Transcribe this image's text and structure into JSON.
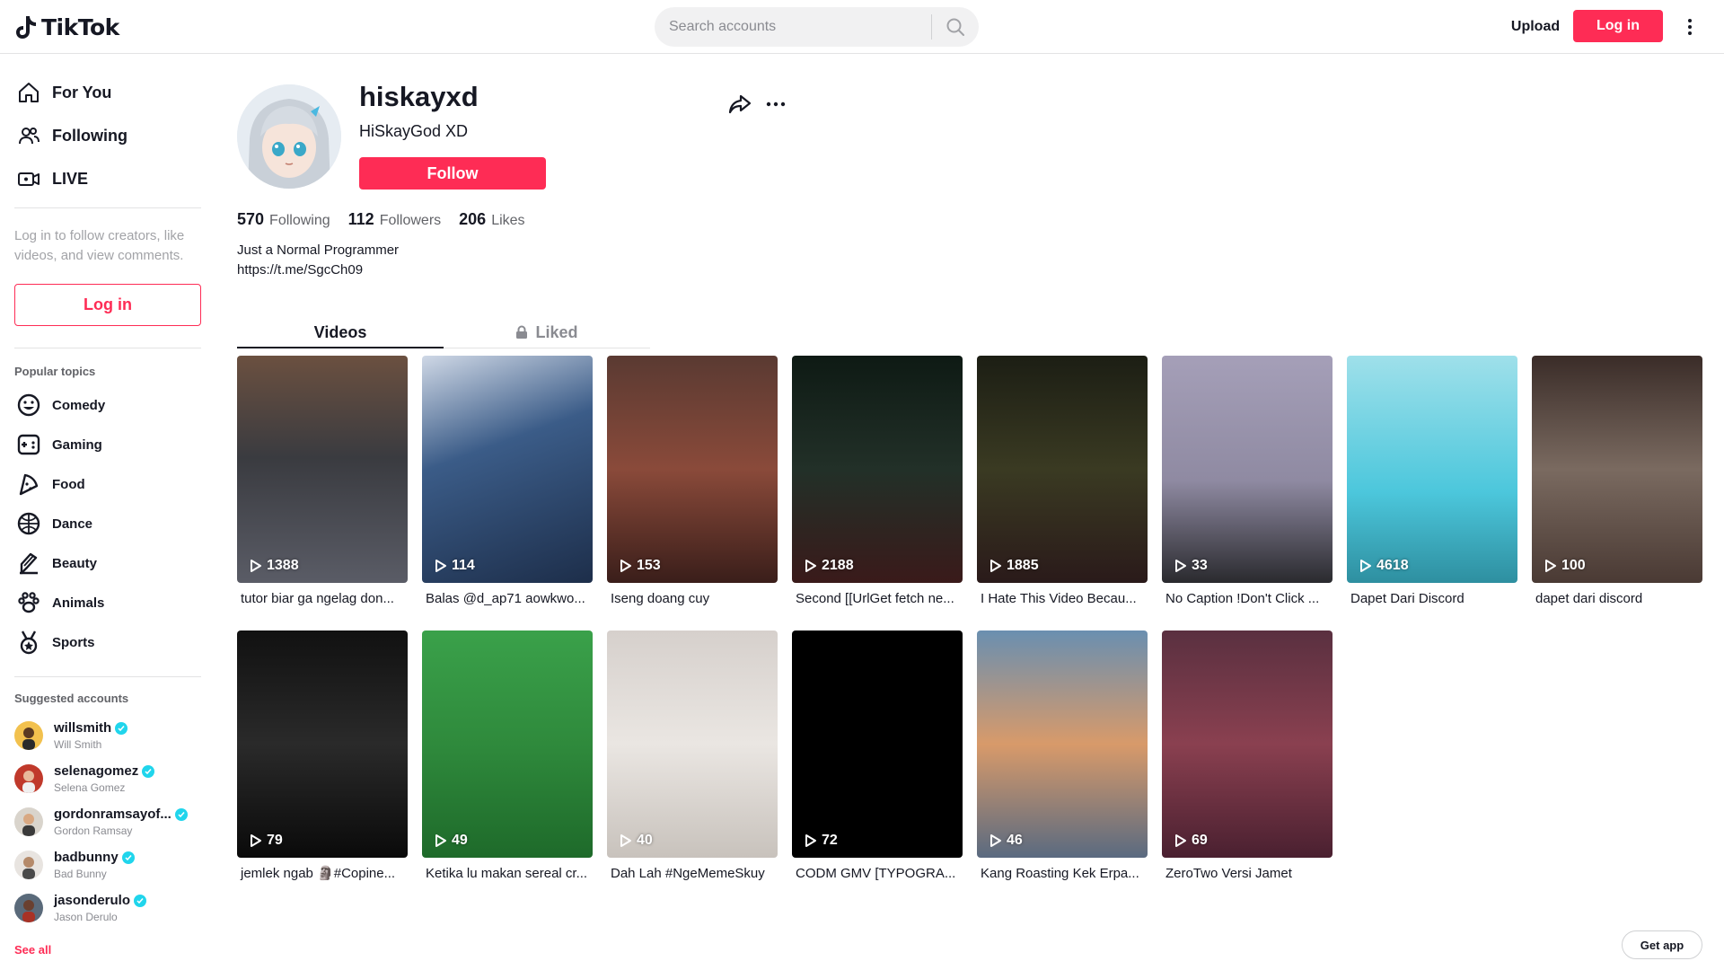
{
  "header": {
    "logo_text": "TikTok",
    "search_placeholder": "Search accounts",
    "upload_label": "Upload",
    "login_label": "Log in"
  },
  "sidebar": {
    "nav": [
      {
        "label": "For You",
        "icon": "home-icon"
      },
      {
        "label": "Following",
        "icon": "users-icon"
      },
      {
        "label": "LIVE",
        "icon": "live-icon"
      }
    ],
    "login_prompt": "Log in to follow creators, like videos, and view comments.",
    "login_button": "Log in",
    "popular_topics_title": "Popular topics",
    "topics": [
      {
        "label": "Comedy",
        "icon": "smile-icon"
      },
      {
        "label": "Gaming",
        "icon": "gamepad-icon"
      },
      {
        "label": "Food",
        "icon": "food-icon"
      },
      {
        "label": "Dance",
        "icon": "dance-icon"
      },
      {
        "label": "Beauty",
        "icon": "beauty-icon"
      },
      {
        "label": "Animals",
        "icon": "paw-icon"
      },
      {
        "label": "Sports",
        "icon": "medal-icon"
      }
    ],
    "suggested_title": "Suggested accounts",
    "suggested": [
      {
        "username": "willsmith",
        "nickname": "Will Smith",
        "color": "#f2c14e"
      },
      {
        "username": "selenagomez",
        "nickname": "Selena Gomez",
        "color": "#c0392b"
      },
      {
        "username": "gordonramsayof...",
        "nickname": "Gordon Ramsay",
        "color": "#6b5b4a"
      },
      {
        "username": "badbunny",
        "nickname": "Bad Bunny",
        "color": "#4a4a4a"
      },
      {
        "username": "jasonderulo",
        "nickname": "Jason Derulo",
        "color": "#a83226"
      }
    ],
    "see_all": "See all"
  },
  "profile": {
    "username": "hiskayxd",
    "nickname": "HiSkayGod XD",
    "follow_label": "Follow",
    "following_count": "570",
    "following_label": "Following",
    "followers_count": "112",
    "followers_label": "Followers",
    "likes_count": "206",
    "likes_label": "Likes",
    "bio_line1": "Just a Normal Programmer",
    "bio_line2": "https://t.me/SgcCh09"
  },
  "tabs": {
    "videos": "Videos",
    "liked": "Liked"
  },
  "videos": [
    {
      "views": "1388",
      "caption": "tutor biar ga ngelag don...",
      "bg": "linear-gradient(180deg,#6b5040 0%,#3a3b40 45%,#5a5c66 100%)"
    },
    {
      "views": "114",
      "caption": "Balas @d_ap71 aowkwo...",
      "bg": "linear-gradient(160deg,#cfd8e6 0%,#3b5c88 40%,#1d2e4a 100%)"
    },
    {
      "views": "153",
      "caption": "Iseng doang cuy",
      "bg": "linear-gradient(180deg,#5a3a32 0%,#8a4a3a 50%,#3a1e1a 100%)"
    },
    {
      "views": "2188",
      "caption": "Second [[UrlGet fetch ne...",
      "bg": "linear-gradient(180deg,#0e1a14 0%,#223028 50%,#3a1a1a 100%)"
    },
    {
      "views": "1885",
      "caption": "I Hate This Video Becau...",
      "bg": "linear-gradient(180deg,#1c1e14 0%,#3a3a22 50%,#2a1a1a 100%)"
    },
    {
      "views": "33",
      "caption": "No Caption !Don't Click ...",
      "bg": "linear-gradient(180deg,#a59fb8 0%,#8f8aa2 55%,#2a2a2e 100%)"
    },
    {
      "views": "4618",
      "caption": "Dapet Dari Discord",
      "bg": "linear-gradient(180deg,#9fe0ea 0%,#4cc7dc 60%,#2e8fa0 100%)"
    },
    {
      "views": "100",
      "caption": "dapet dari discord",
      "bg": "linear-gradient(180deg,#3a2c28 0%,#7a6a60 50%,#4a3a34 100%)"
    },
    {
      "views": "79",
      "caption": "jemlek ngab 🗿#Copine...",
      "bg": "linear-gradient(180deg,#111 0%,#2a2a2a 50%,#0a0a0a 100%)"
    },
    {
      "views": "49",
      "caption": "Ketika lu makan sereal cr...",
      "bg": "linear-gradient(180deg,#3aa14a 0%,#2f8a3c 50%,#1e6a2a 100%)"
    },
    {
      "views": "40",
      "caption": "Dah Lah #NgeMemeSkuy",
      "bg": "linear-gradient(180deg,#d6d0cc 0%,#eae6e2 50%,#c8c2bc 100%)"
    },
    {
      "views": "72",
      "caption": "CODM GMV [TYPOGRA...",
      "bg": "#000000"
    },
    {
      "views": "46",
      "caption": "Kang Roasting Kek Erpa...",
      "bg": "linear-gradient(180deg,#6a8fb0 0%,#d89a6a 50%,#5a6a80 100%)"
    },
    {
      "views": "69",
      "caption": "ZeroTwo Versi Jamet",
      "bg": "linear-gradient(180deg,#5a3040 0%,#8a4050 50%,#4a2030 100%)"
    }
  ],
  "get_app": "Get app",
  "colors": {
    "accent": "#fe2c55",
    "verified": "#20d5ec"
  }
}
